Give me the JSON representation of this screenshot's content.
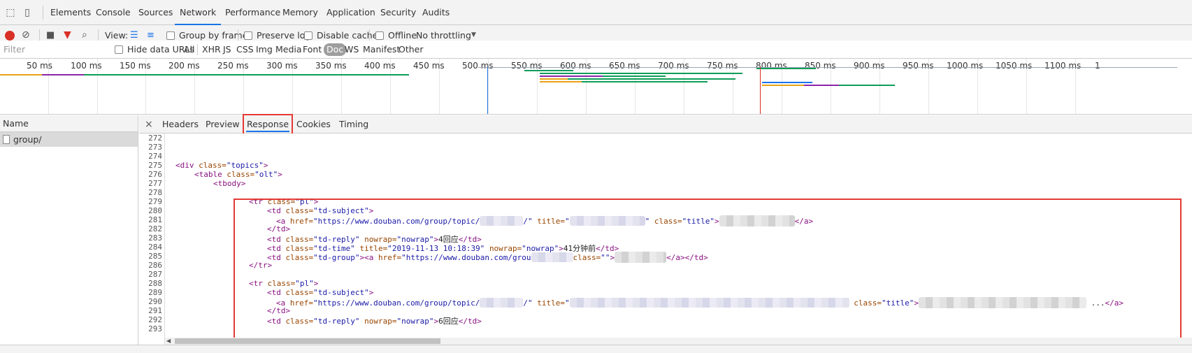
{
  "main_tabs": [
    "Elements",
    "Console",
    "Sources",
    "Network",
    "Performance",
    "Memory",
    "Application",
    "Security",
    "Audits"
  ],
  "active_main_tab": "Network",
  "controls": {
    "view_label": "View:",
    "group_by_frame": "Group by frame",
    "preserve_log": "Preserve log",
    "disable_cache": "Disable cache",
    "offline": "Offline",
    "throttling": "No throttling"
  },
  "filter": {
    "placeholder": "Filter",
    "hide_data_urls": "Hide data URLs",
    "types": [
      "All",
      "XHR",
      "JS",
      "CSS",
      "Img",
      "Media",
      "Font",
      "Doc",
      "WS",
      "Manifest",
      "Other"
    ],
    "active_type": "Doc"
  },
  "overview": {
    "ticks": [
      "50 ms",
      "100 ms",
      "150 ms",
      "200 ms",
      "250 ms",
      "300 ms",
      "350 ms",
      "400 ms",
      "450 ms",
      "500 ms",
      "550 ms",
      "600 ms",
      "650 ms",
      "700 ms",
      "750 ms",
      "800 ms",
      "850 ms",
      "900 ms",
      "950 ms",
      "1000 ms",
      "1050 ms",
      "1100 ms",
      "1"
    ],
    "colors": {
      "green": "#0f9d58",
      "orange": "#e8a317",
      "purple": "#8e24aa",
      "blue": "#1a73e8",
      "red": "#d93025"
    }
  },
  "name_pane": {
    "header": "Name",
    "rows": [
      "group/"
    ]
  },
  "detail_tabs": [
    "Headers",
    "Preview",
    "Response",
    "Cookies",
    "Timing"
  ],
  "active_detail_tab": "Response",
  "close_glyph": "×",
  "code": {
    "line_numbers": [
      "272",
      "273",
      "274",
      "275",
      "276",
      "277",
      "278",
      "279",
      "280",
      "281",
      "282",
      "283",
      "284",
      "285",
      "286",
      "287",
      "288",
      "289",
      "290",
      "291",
      "292",
      "293"
    ],
    "l275_tag": "<div ",
    "l275_attr": "class=",
    "l275_val": "\"topics\"",
    "l275_end": ">",
    "l276_tag": "<table ",
    "l276_attr": "class=",
    "l276_val": "\"olt\"",
    "l276_end": ">",
    "l277_tag": "<tbody>",
    "l279_tag": "<tr ",
    "l279_attr": "class=",
    "l279_val": "\"pl\"",
    "l279_end": ">",
    "l280_tag": "<td ",
    "l280_attr": "class=",
    "l280_val": "\"td-subject\"",
    "l280_end": ">",
    "l281_a": "<a ",
    "l281_href": "href=",
    "l281_hval": "\"https://www.douban.com/group/topic/",
    "l281_q": "/\" ",
    "l281_title": "title=",
    "l281_tq": "\"",
    "l281_q2": "\" ",
    "l281_class": "class=",
    "l281_cval": "\"title\"",
    "l281_gt": ">",
    "l281_close": "</a>",
    "l282": "</td>",
    "l283_tag": "<td ",
    "l283_attr": "class=",
    "l283_val": "\"td-reply\" ",
    "l283_attr2": "nowrap=",
    "l283_val2": "\"nowrap\"",
    "l283_gt": ">",
    "l283_text": "4回应",
    "l283_close": "</td>",
    "l284_tag": "<td ",
    "l284_attr": "class=",
    "l284_val": "\"td-time\" ",
    "l284_attr2": "title=",
    "l284_val2": "\"2019-11-13 10:18:39\" ",
    "l284_attr3": "nowrap=",
    "l284_val3": "\"nowrap\"",
    "l284_gt": ">",
    "l284_text": "41分钟前",
    "l284_close": "</td>",
    "l285_tag": "<td ",
    "l285_attr": "class=",
    "l285_val": "\"td-group\"",
    "l285_gt": ">",
    "l285_a": "<a ",
    "l285_href": "href=",
    "l285_hval": "\"https://www.douban.com/grou",
    "l285_class": "class=",
    "l285_cval": "\"\"",
    "l285_gt2": ">",
    "l285_close": "</a></td>",
    "l286": "</tr>",
    "l288_tag": "<tr ",
    "l288_attr": "class=",
    "l288_val": "\"pl\"",
    "l288_end": ">",
    "l289_tag": "<td ",
    "l289_attr": "class=",
    "l289_val": "\"td-subject\"",
    "l289_end": ">",
    "l290_a": "<a ",
    "l290_href": "href=",
    "l290_hval": "\"https://www.douban.com/group/topic/",
    "l290_q": "/\" ",
    "l290_title": "title=",
    "l290_tq": "\"",
    "l290_class": "class=",
    "l290_cval": "\"title\"",
    "l290_gt": ">",
    "l290_ell": " ...",
    "l290_close": "</a>",
    "l291": "</td>",
    "l292_tag": "<td ",
    "l292_attr": "class=",
    "l292_val": "\"td-reply\" ",
    "l292_attr2": "nowrap=",
    "l292_val2": "\"nowrap\"",
    "l292_gt": ">",
    "l292_text": "6回应",
    "l292_close": "</td>"
  }
}
